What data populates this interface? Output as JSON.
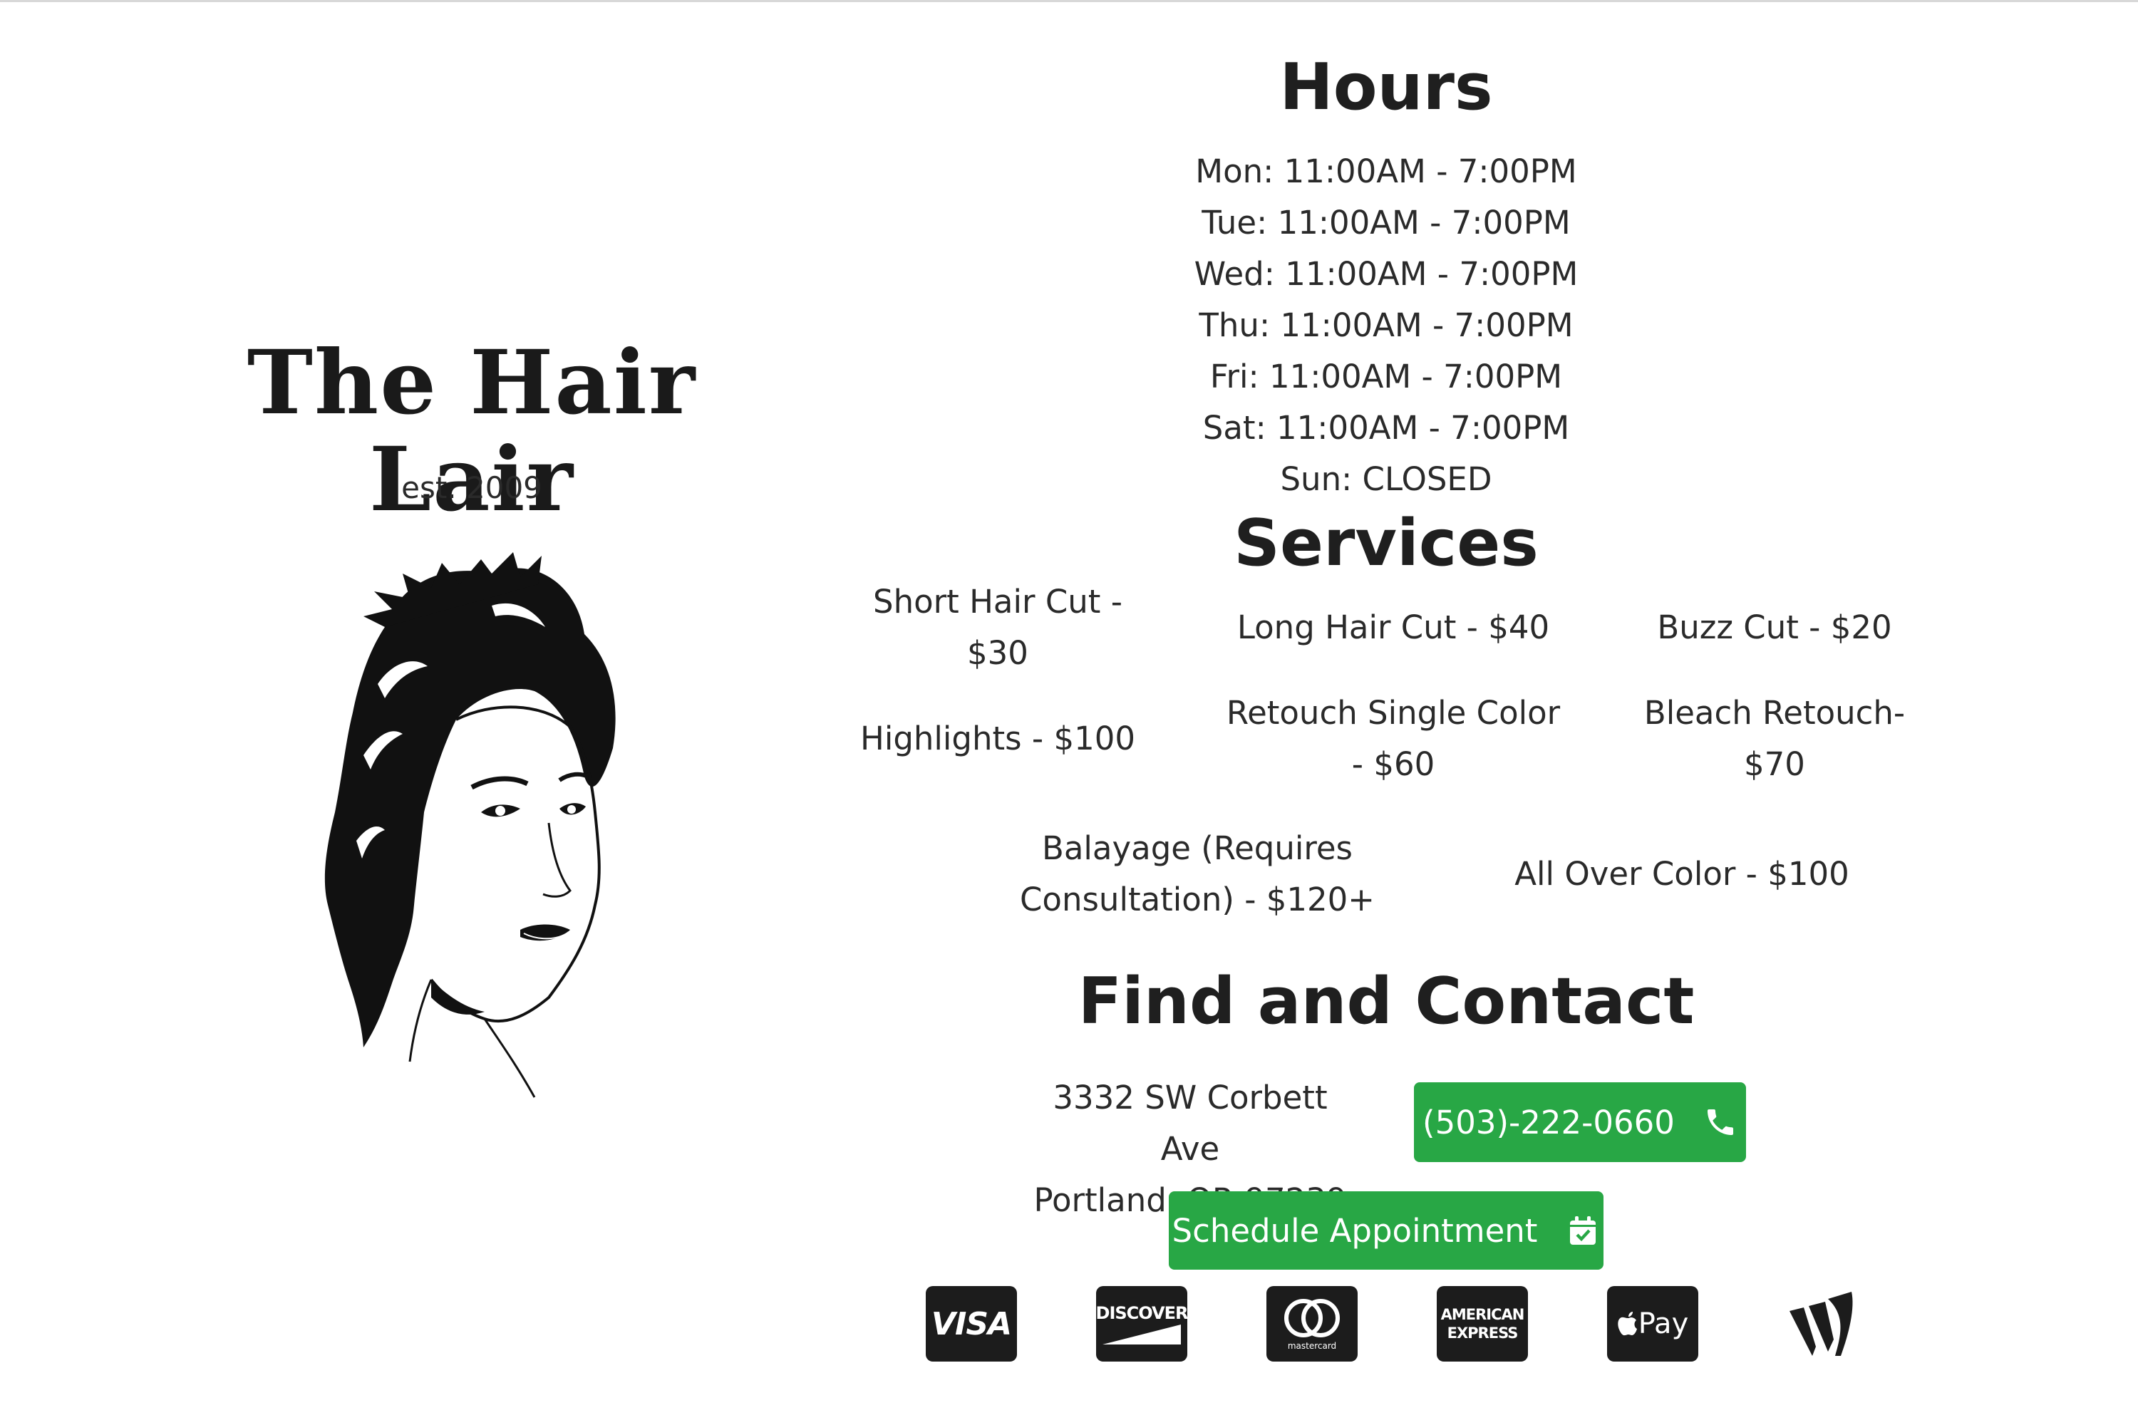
{
  "brand": {
    "name": "The Hair Lair",
    "established": "est. 2009"
  },
  "hours": {
    "heading": "Hours",
    "days": [
      "Mon: 11:00AM - 7:00PM",
      "Tue: 11:00AM - 7:00PM",
      "Wed: 11:00AM - 7:00PM",
      "Thu: 11:00AM - 7:00PM",
      "Fri: 11:00AM - 7:00PM",
      "Sat: 11:00AM - 7:00PM",
      "Sun: CLOSED"
    ]
  },
  "services": {
    "heading": "Services",
    "items": [
      "Short Hair Cut - $30",
      "Long Hair Cut - $40",
      "Buzz Cut - $20",
      "Highlights - $100",
      "Retouch Single Color - $60",
      "Bleach Retouch- $70",
      "Balayage (Requires Consultation) - $120+",
      "All Over Color - $100"
    ]
  },
  "contact": {
    "heading": "Find and Contact",
    "address_line1": "3332 SW Corbett Ave",
    "address_line2": "Portland, OR 97239",
    "phone_label": "(503)-222-0660",
    "phone_icon": "phone-icon",
    "schedule_label": "Schedule Appointment",
    "schedule_icon": "calendar-check-icon",
    "accent_color": "#28a745"
  },
  "payments": {
    "visa": "VISA",
    "discover": "DISCOVER",
    "mastercard": "mastercard",
    "amex_line1": "AMERICAN",
    "amex_line2": "EXPRESS",
    "applepay": "Pay",
    "venmo_icon": "venmo-icon"
  }
}
